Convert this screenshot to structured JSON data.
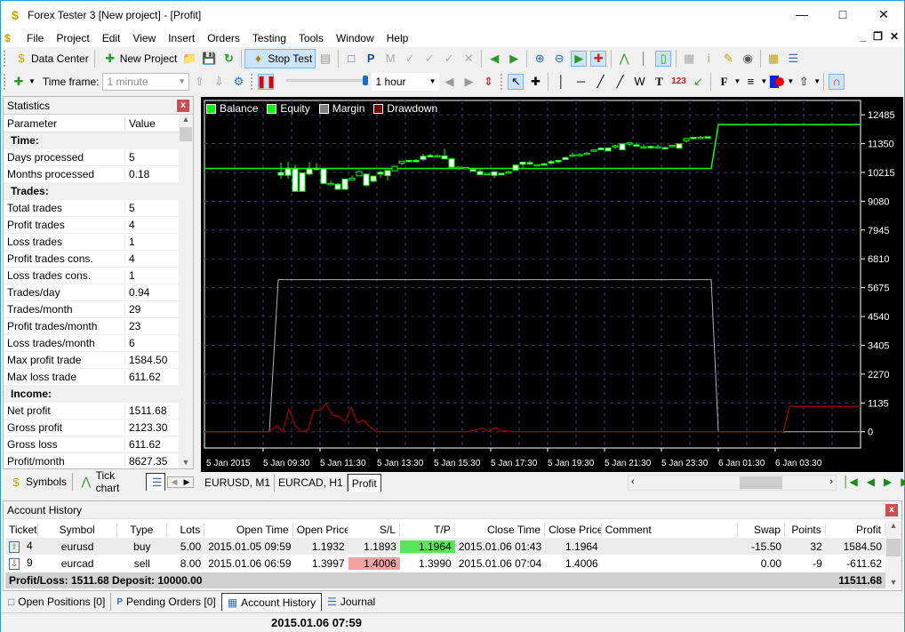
{
  "window": {
    "title": "Forex Tester 3  [New project] - [Profit]"
  },
  "menu": [
    "File",
    "Project",
    "Edit",
    "View",
    "Insert",
    "Orders",
    "Testing",
    "Tools",
    "Window",
    "Help"
  ],
  "toolbar1": {
    "data_center": "Data Center",
    "new_project": "New Project",
    "stop_test": "Stop Test"
  },
  "toolbar2": {
    "timeframe_label": "Time frame:",
    "timeframe_value": "1 minute",
    "speed_value": "1 hour"
  },
  "stats": {
    "title": "Statistics",
    "headers": [
      "Parameter",
      "Value"
    ],
    "rows": [
      {
        "group": "Time:"
      },
      {
        "p": "Days processed",
        "v": "5"
      },
      {
        "p": "Months processed",
        "v": "0.18"
      },
      {
        "group": "Trades:"
      },
      {
        "p": "Total trades",
        "v": "5"
      },
      {
        "p": "Profit trades",
        "v": "4"
      },
      {
        "p": "Loss trades",
        "v": "1"
      },
      {
        "p": "Profit trades cons.",
        "v": "4"
      },
      {
        "p": "Loss trades cons.",
        "v": "1"
      },
      {
        "p": "Trades/day",
        "v": "0.94"
      },
      {
        "p": "Trades/month",
        "v": "29"
      },
      {
        "p": "Profit trades/month",
        "v": "23"
      },
      {
        "p": "Loss trades/month",
        "v": "6"
      },
      {
        "p": "Max profit trade",
        "v": "1584.50"
      },
      {
        "p": "Max loss trade",
        "v": "611.62"
      },
      {
        "group": "Income:"
      },
      {
        "p": "Net profit",
        "v": "1511.68"
      },
      {
        "p": "Gross profit",
        "v": "2123.30"
      },
      {
        "p": "Gross loss",
        "v": "611.62"
      },
      {
        "p": "Profit/month",
        "v": "8627.35"
      }
    ]
  },
  "left_tabs": [
    "Symbols",
    "Tick chart"
  ],
  "chart": {
    "legend": [
      {
        "name": "Balance",
        "color": "#00ff00"
      },
      {
        "name": "Equity",
        "color": "#00ff00"
      },
      {
        "name": "Margin",
        "color": "#808080"
      },
      {
        "name": "Drawdown",
        "color": "#800000"
      }
    ],
    "y_ticks": [
      "12485",
      "11350",
      "10215",
      "9080",
      "7945",
      "6810",
      "5675",
      "4540",
      "3405",
      "2270",
      "1135",
      "0"
    ],
    "x_ticks": [
      "5 Jan 2015",
      "5 Jan 09:30",
      "5 Jan 11:30",
      "5 Jan 13:30",
      "5 Jan 15:30",
      "5 Jan 17:30",
      "5 Jan 19:30",
      "5 Jan 21:30",
      "5 Jan 23:30",
      "6 Jan 01:30",
      "6 Jan 03:30"
    ]
  },
  "chart_tabs": [
    "EURUSD, M1",
    "EURCAD, H1",
    "Profit"
  ],
  "history": {
    "title": "Account History",
    "headers": [
      "Ticket",
      "Symbol",
      "Type",
      "Lots",
      "Open Time",
      "Open Price",
      "S/L",
      "T/P",
      "Close Time",
      "Close Price",
      "Comment",
      "Swap",
      "Points",
      "Profit"
    ],
    "rows": [
      [
        "4",
        "eurusd",
        "buy",
        "5.00",
        "2015.01.05 09:59",
        "1.1932",
        "1.1893",
        "1.1964",
        "2015.01.06 01:43",
        "1.1964",
        "",
        "-15.50",
        "32",
        "1584.50"
      ],
      [
        "9",
        "eurcad",
        "sell",
        "8.00",
        "2015.01.06 06:59",
        "1.3997",
        "1.4006",
        "1.3990",
        "2015.01.06 07:04",
        "1.4006",
        "",
        "0.00",
        "-9",
        "-611.62"
      ]
    ],
    "footer_left": "Profit/Loss: 1511.68 Deposit: 10000.00",
    "footer_right": "11511.68",
    "colors": {
      "tp_hit": "#5be55b",
      "sl_hit": "#f5a0a0"
    }
  },
  "bottom_tabs": [
    "Open Positions [0]",
    "Pending Orders [0]",
    "Account History",
    "Journal"
  ],
  "status": {
    "time": "2015.01.06 07:59"
  }
}
